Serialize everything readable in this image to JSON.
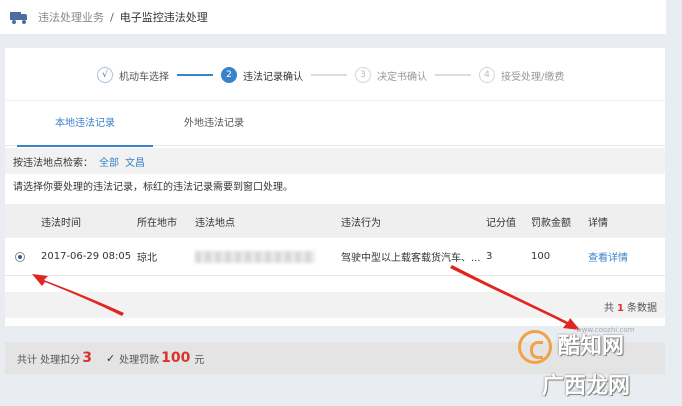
{
  "breadcrumb": {
    "parent": "违法处理业务",
    "separator": "/",
    "current": "电子监控违法处理"
  },
  "steps": [
    {
      "num": "√",
      "label": "机动车选择",
      "state": "done"
    },
    {
      "num": "2",
      "label": "违法记录确认",
      "state": "active"
    },
    {
      "num": "3",
      "label": "决定书确认",
      "state": "todo"
    },
    {
      "num": "4",
      "label": "接受处理/缴费",
      "state": "todo"
    }
  ],
  "tabs": [
    {
      "label": "本地违法记录",
      "active": true
    },
    {
      "label": "外地违法记录",
      "active": false
    }
  ],
  "filter": {
    "label": "按违法地点检索：",
    "options": [
      "全部",
      "文昌"
    ]
  },
  "hint": "请选择你要处理的违法记录，标红的违法记录需要到窗口处理。",
  "table": {
    "headers": [
      "违法时间",
      "所在地市",
      "违法地点",
      "违法行为",
      "记分值",
      "罚款金额",
      "详情"
    ],
    "rows": [
      {
        "time": "2017-06-29 08:05",
        "city": "琼北",
        "location": "",
        "behavior": "驾驶中型以上载客载货汽车、...",
        "points": "3",
        "fine": "100",
        "detail": "查看详情"
      }
    ]
  },
  "total": {
    "prefix": "共",
    "count": "1",
    "suffix": "条数据"
  },
  "footer": {
    "label1": "共计 处理扣分",
    "points": "3",
    "check": "✓",
    "label2": "处理罚款",
    "fine": "100",
    "unit": "元"
  },
  "watermark": {
    "text1": "酷知网",
    "url": "www.coozhi.com",
    "text2": "广西龙网"
  },
  "colors": {
    "accent": "#3a82c9",
    "danger": "#d9332b",
    "annotation": "#e0271f"
  }
}
